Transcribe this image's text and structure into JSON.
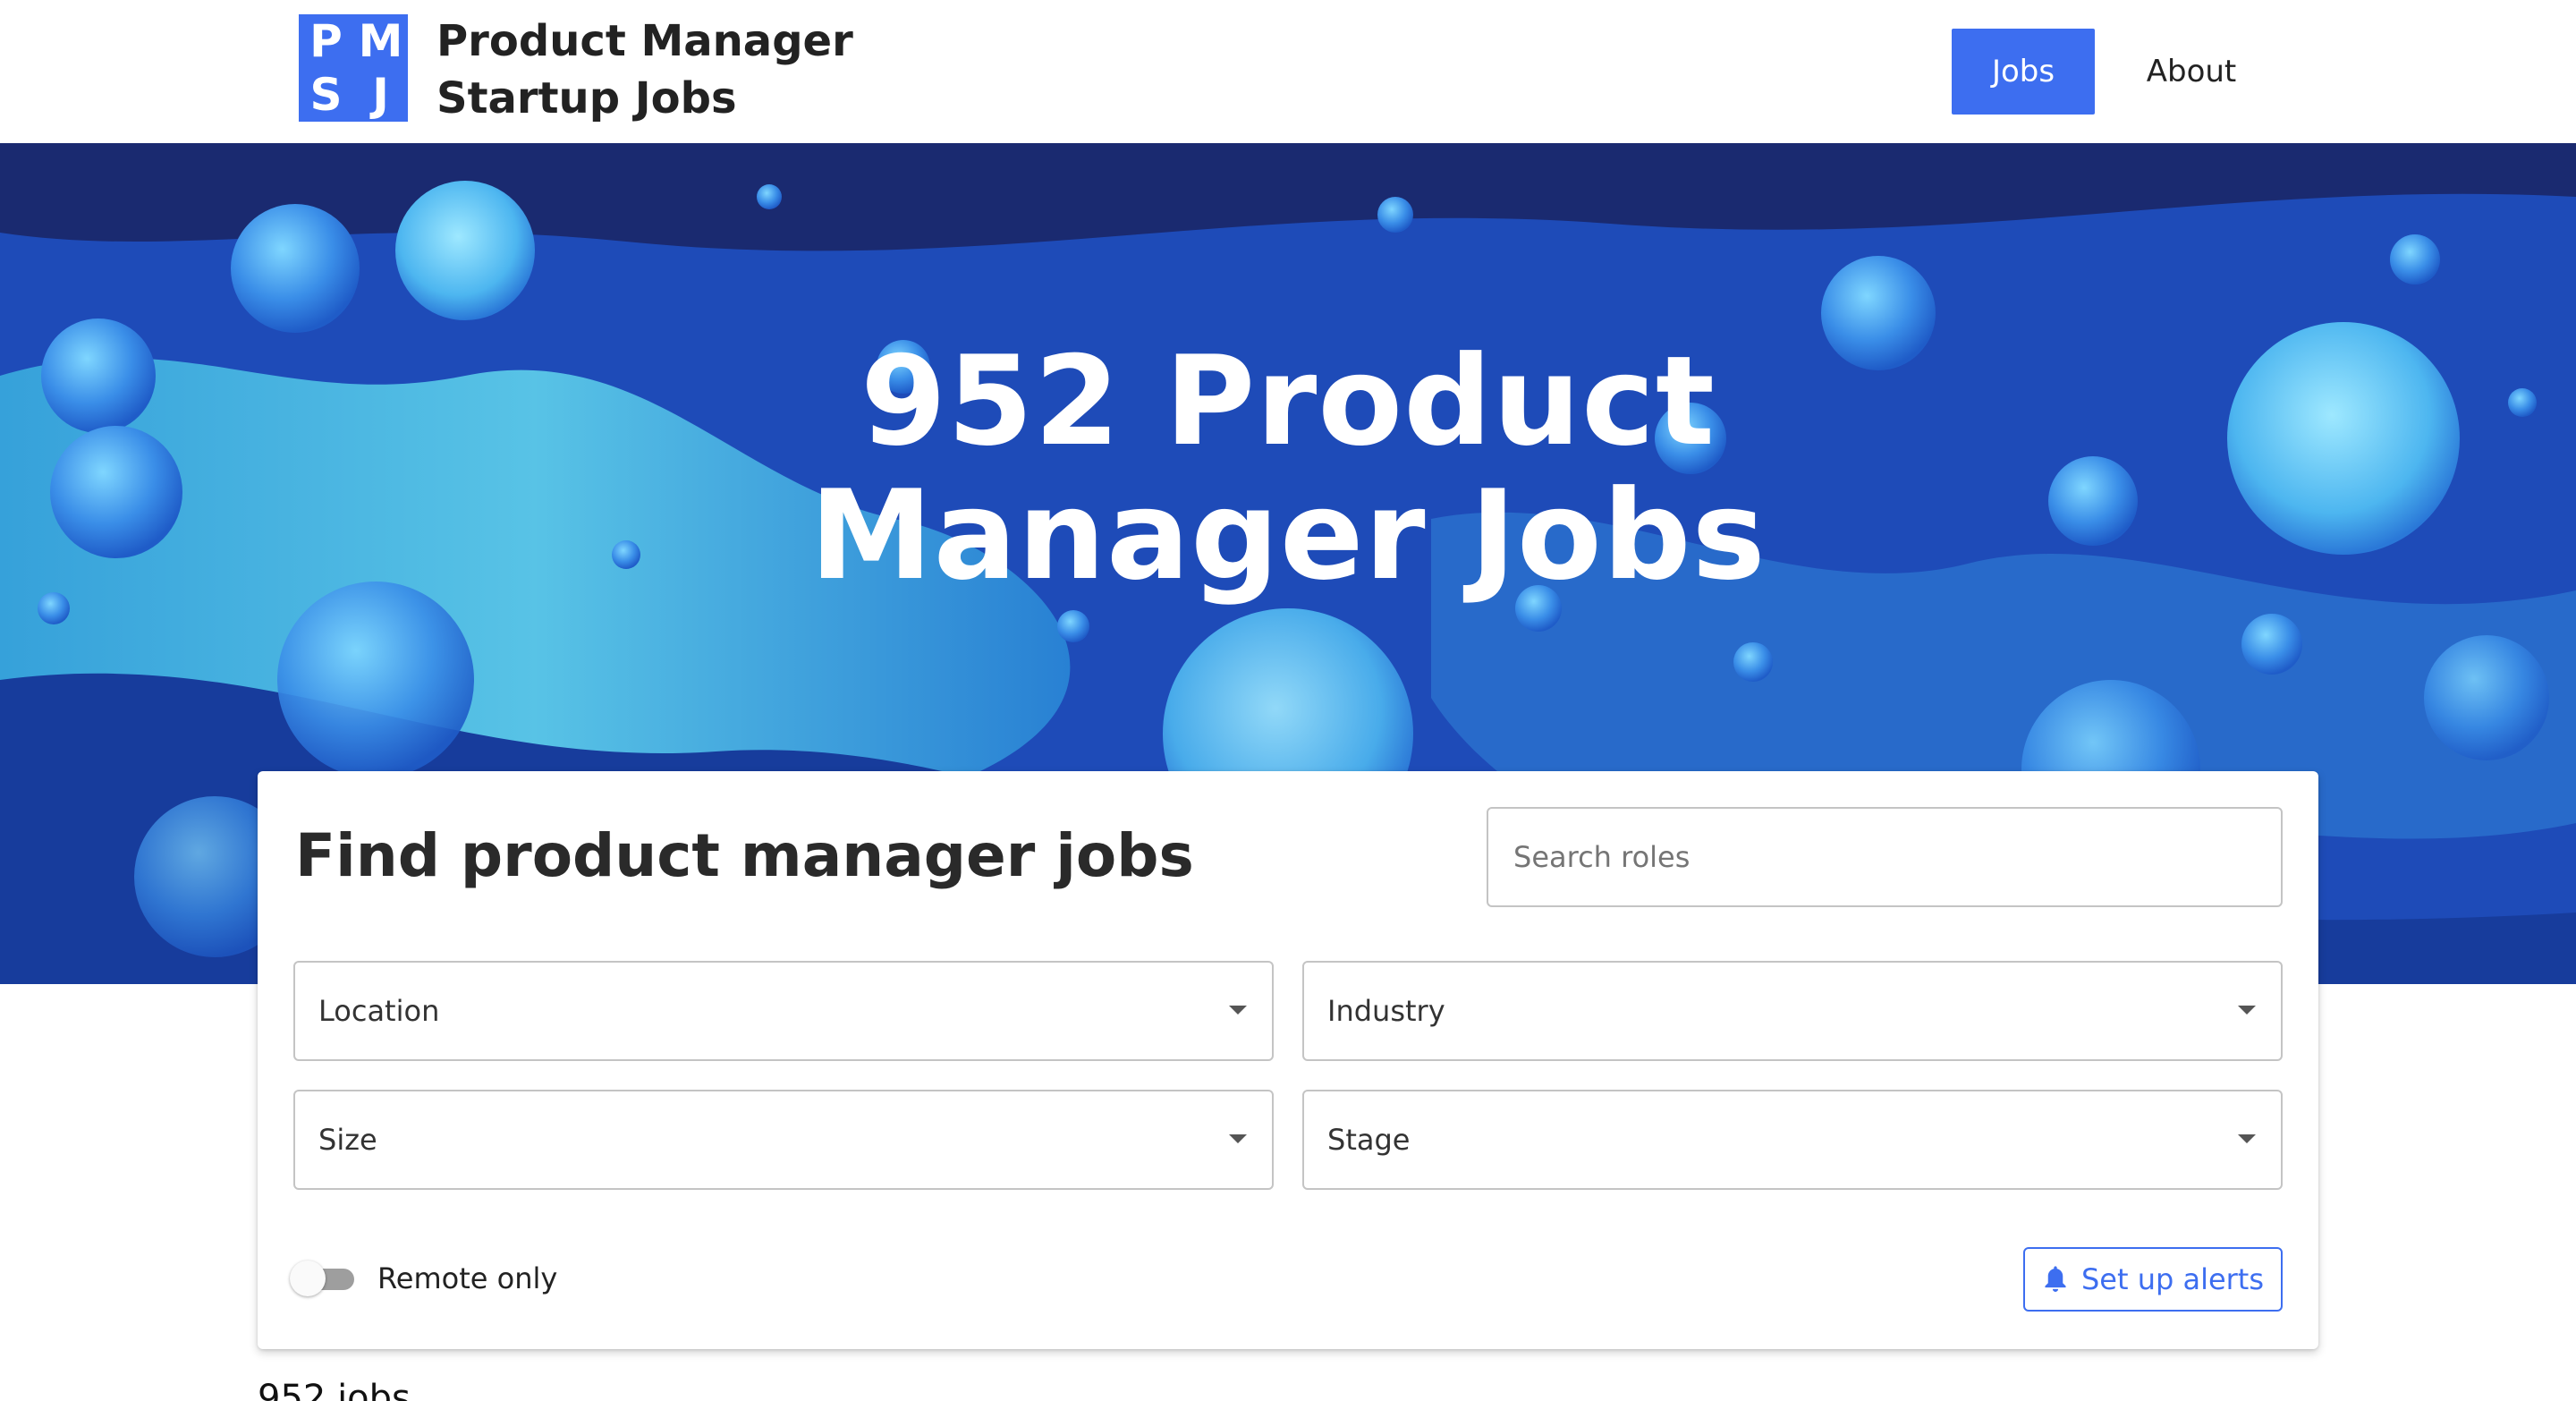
{
  "header": {
    "logo_letters": [
      "P",
      "M",
      "S",
      "J"
    ],
    "brand_line1": "Product Manager",
    "brand_line2": "Startup Jobs",
    "nav": {
      "jobs_label": "Jobs",
      "about_label": "About"
    },
    "accent_color": "#3d6ef0"
  },
  "hero": {
    "title_line1": "952 Product",
    "title_line2": "Manager Jobs"
  },
  "search": {
    "heading": "Find product manager jobs",
    "search_placeholder": "Search roles",
    "filters": {
      "location": "Location",
      "industry": "Industry",
      "size": "Size",
      "stage": "Stage"
    },
    "remote_only_label": "Remote only",
    "remote_only_on": false,
    "alerts_label": "Set up alerts",
    "alerts_icon": "bell-icon"
  },
  "results": {
    "count_text": "952 jobs"
  }
}
